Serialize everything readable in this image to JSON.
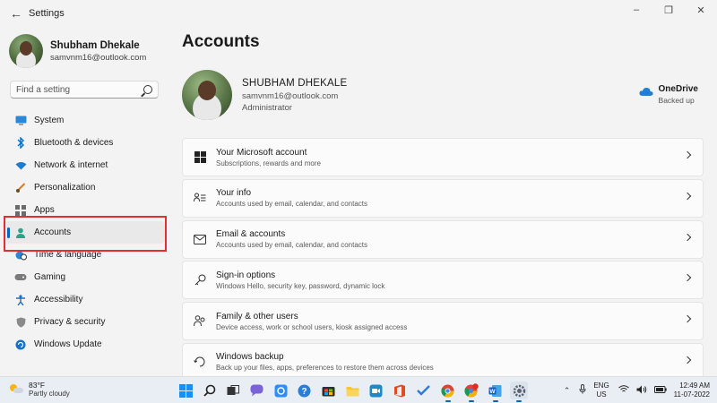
{
  "window": {
    "title": "Settings",
    "back_icon": "back-arrow-icon",
    "controls": [
      "minimize",
      "maximize",
      "close"
    ]
  },
  "sidebar": {
    "user_name": "Shubham Dhekale",
    "user_email": "samvnm16@outlook.com",
    "search_placeholder": "Find a setting",
    "items": [
      {
        "label": "System",
        "icon": "system-icon"
      },
      {
        "label": "Bluetooth & devices",
        "icon": "bluetooth-icon"
      },
      {
        "label": "Network & internet",
        "icon": "wifi-icon"
      },
      {
        "label": "Personalization",
        "icon": "brush-icon"
      },
      {
        "label": "Apps",
        "icon": "apps-icon"
      },
      {
        "label": "Accounts",
        "icon": "person-icon",
        "active": true
      },
      {
        "label": "Time & language",
        "icon": "globe-clock-icon"
      },
      {
        "label": "Gaming",
        "icon": "gamepad-icon"
      },
      {
        "label": "Accessibility",
        "icon": "accessibility-icon"
      },
      {
        "label": "Privacy & security",
        "icon": "shield-icon"
      },
      {
        "label": "Windows Update",
        "icon": "update-icon"
      }
    ]
  },
  "main": {
    "title": "Accounts",
    "account": {
      "name": "SHUBHAM DHEKALE",
      "email": "samvnm16@outlook.com",
      "role": "Administrator"
    },
    "onedrive": {
      "name": "OneDrive",
      "status": "Backed up"
    },
    "cards": [
      {
        "title": "Your Microsoft account",
        "subtitle": "Subscriptions, rewards and more",
        "icon": "windows-logo-icon"
      },
      {
        "title": "Your info",
        "subtitle": "Accounts used by email, calendar, and contacts",
        "icon": "person-card-icon"
      },
      {
        "title": "Email & accounts",
        "subtitle": "Accounts used by email, calendar, and contacts",
        "icon": "mail-icon"
      },
      {
        "title": "Sign-in options",
        "subtitle": "Windows Hello, security key, password, dynamic lock",
        "icon": "key-icon"
      },
      {
        "title": "Family & other users",
        "subtitle": "Device access, work or school users, kiosk assigned access",
        "icon": "people-icon"
      },
      {
        "title": "Windows backup",
        "subtitle": "Back up your files, apps, preferences to restore them across devices",
        "icon": "backup-icon"
      }
    ]
  },
  "taskbar": {
    "weather_temp": "83°F",
    "weather_desc": "Partly cloudy",
    "lang_line1": "ENG",
    "lang_line2": "US",
    "time": "12:49 AM",
    "date": "11-07-2022",
    "apps": [
      "start-icon",
      "search-icon",
      "task-view-icon",
      "teams-chat-icon",
      "store-icon",
      "help-icon",
      "store-bag-icon",
      "file-explorer-icon",
      "zoom-icon",
      "office-icon",
      "todo-icon",
      "chrome-icon",
      "chrome-profile-icon",
      "word-icon",
      "settings-gear-icon"
    ],
    "accent": "#0067c0"
  }
}
